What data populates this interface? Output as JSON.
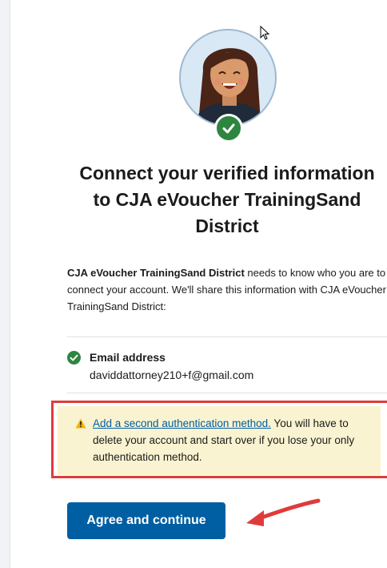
{
  "colors": {
    "brand_blue": "#005ea2",
    "success_green": "#2e8540",
    "warning_bg": "#faf3d1",
    "annotation_red": "#e03b3b"
  },
  "header": {
    "title_line1": "Connect your verified information",
    "title_line2": "to CJA eVoucher TrainingSand",
    "title_line3": "District"
  },
  "intro": {
    "agency": "CJA eVoucher TrainingSand District",
    "text_part1": " needs to know who you are to connect your account. We'll share this information with CJA eVoucher TrainingSand District:"
  },
  "attributes": [
    {
      "label": "Email address",
      "value": "daviddattorney210+f@gmail.com",
      "icon": "check-circle-icon"
    }
  ],
  "warning": {
    "icon": "warning-triangle-icon",
    "link_text": "Add a second authentication method.",
    "text": " You will have to delete your account and start over if you lose your only authentication method."
  },
  "actions": {
    "agree_label": "Agree and continue"
  }
}
